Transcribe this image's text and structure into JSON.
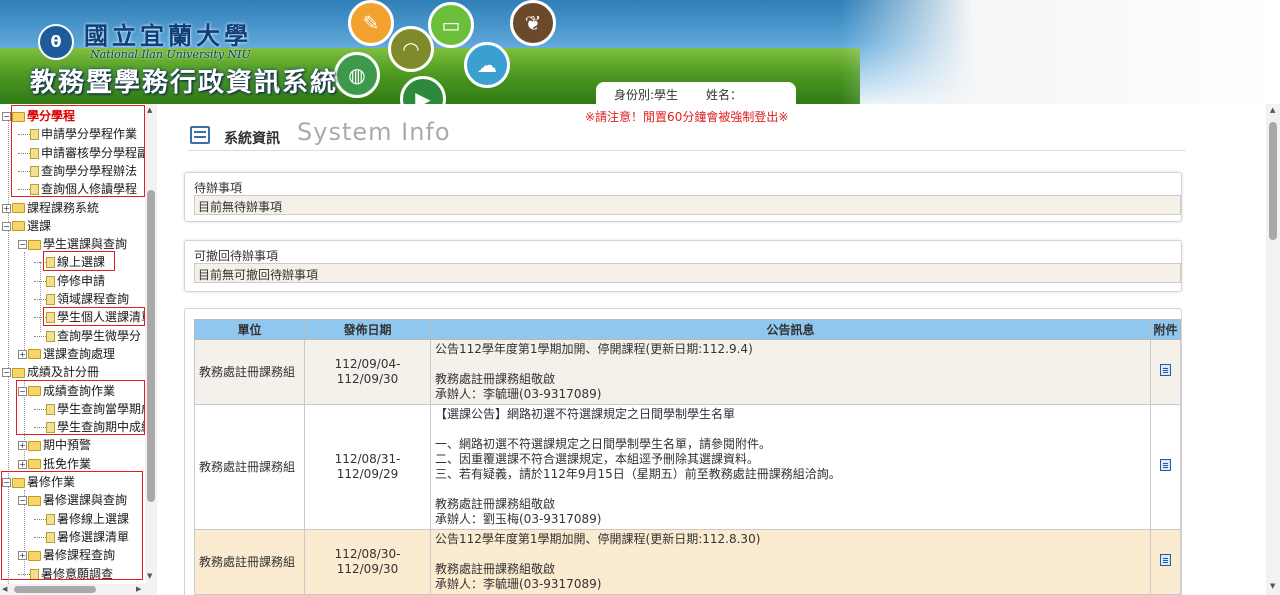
{
  "header": {
    "logo_text": "θ",
    "university_name": "國立宜蘭大學",
    "university_name_en": "National Ilan University  NIU",
    "system_title": "教務暨學務行政資訊系統",
    "identity_label": "身份別:學生",
    "name_label": "姓名：",
    "icons": [
      "palette-icon",
      "book-icon",
      "wifi-icon",
      "cloud-icon",
      "leaf-icon",
      "globe-icon",
      "video-icon"
    ]
  },
  "notice": "※請注意！閒置60分鐘會被強制登出※",
  "sidebar": {
    "items": [
      {
        "label": "學分學程",
        "level": 0,
        "type": "folder"
      },
      {
        "label": "申請學分學程作業",
        "level": 1,
        "type": "doc"
      },
      {
        "label": "申請審核學分學程副",
        "level": 1,
        "type": "doc"
      },
      {
        "label": "查詢學分學程辦法",
        "level": 1,
        "type": "doc"
      },
      {
        "label": "查詢個人修讀學程",
        "level": 1,
        "type": "doc"
      },
      {
        "label": "課程課務系統",
        "level": 0,
        "type": "folder"
      },
      {
        "label": "選課",
        "level": 0,
        "type": "folder"
      },
      {
        "label": "學生選課與查詢",
        "level": 1,
        "type": "folder"
      },
      {
        "label": "線上選課",
        "level": 2,
        "type": "doc"
      },
      {
        "label": "停修申請",
        "level": 2,
        "type": "doc"
      },
      {
        "label": "領域課程查詢",
        "level": 2,
        "type": "doc"
      },
      {
        "label": "學生個人選課清單",
        "level": 2,
        "type": "doc"
      },
      {
        "label": "查詢學生微學分",
        "level": 2,
        "type": "doc"
      },
      {
        "label": "選課查詢處理",
        "level": 1,
        "type": "folder"
      },
      {
        "label": "成績及計分冊",
        "level": 0,
        "type": "folder"
      },
      {
        "label": "成績查詢作業",
        "level": 1,
        "type": "folder"
      },
      {
        "label": "學生查詢當學期成",
        "level": 2,
        "type": "doc"
      },
      {
        "label": "學生查詢期中成績",
        "level": 2,
        "type": "doc"
      },
      {
        "label": "期中預警",
        "level": 1,
        "type": "folder"
      },
      {
        "label": "抵免作業",
        "level": 1,
        "type": "folder"
      },
      {
        "label": "暑修作業",
        "level": 0,
        "type": "folder"
      },
      {
        "label": "暑修選課與查詢",
        "level": 1,
        "type": "folder"
      },
      {
        "label": "暑修線上選課",
        "level": 2,
        "type": "doc"
      },
      {
        "label": "暑修選課清單",
        "level": 2,
        "type": "doc"
      },
      {
        "label": "暑修課程查詢",
        "level": 1,
        "type": "folder"
      },
      {
        "label": "暑修意願調查",
        "level": 1,
        "type": "doc"
      }
    ]
  },
  "main": {
    "title": "系統資訊",
    "title_en": "System Info",
    "todo": {
      "title": "待辦事項",
      "value": "目前無待辦事項"
    },
    "revocable": {
      "title": "可撤回待辦事項",
      "value": "目前無可撤回待辦事項"
    },
    "announcements": {
      "columns": [
        "單位",
        "發佈日期",
        "公告訊息",
        "附件"
      ],
      "rows": [
        {
          "unit": "教務處註冊課務組",
          "date": "112/09/04-112/09/30",
          "lines": [
            "公告112學年度第1學期加開、停開課程(更新日期:112.9.4)",
            "",
            "教務處註冊課務組敬啟",
            "承辦人：李毓珊(03-9317089)"
          ]
        },
        {
          "unit": "教務處註冊課務組",
          "date": "112/08/31-112/09/29",
          "lines": [
            "【選課公告】網路初選不符選課規定之日間學制學生名單",
            "",
            "一、網路初選不符選課規定之日間學制學生名單，請參閱附件。",
            "二、因重覆選課不符合選課規定，本組逕予刪除其選課資料。",
            "三、若有疑義，請於112年9月15日（星期五）前至教務處註冊課務組洽詢。",
            "",
            "教務處註冊課務組敬啟",
            "承辦人：劉玉梅(03-9317089)"
          ]
        },
        {
          "unit": "教務處註冊課務組",
          "date": "112/08/30-112/09/30",
          "lines": [
            "公告112學年度第1學期加開、停開課程(更新日期:112.8.30)",
            "",
            "教務處註冊課務組敬啟",
            "承辦人：李毓珊(03-9317089)"
          ]
        }
      ]
    }
  },
  "colors": {
    "table_header": "#8fc7ef",
    "highlight_row": "#fbebd0",
    "notice": "#e02020"
  }
}
